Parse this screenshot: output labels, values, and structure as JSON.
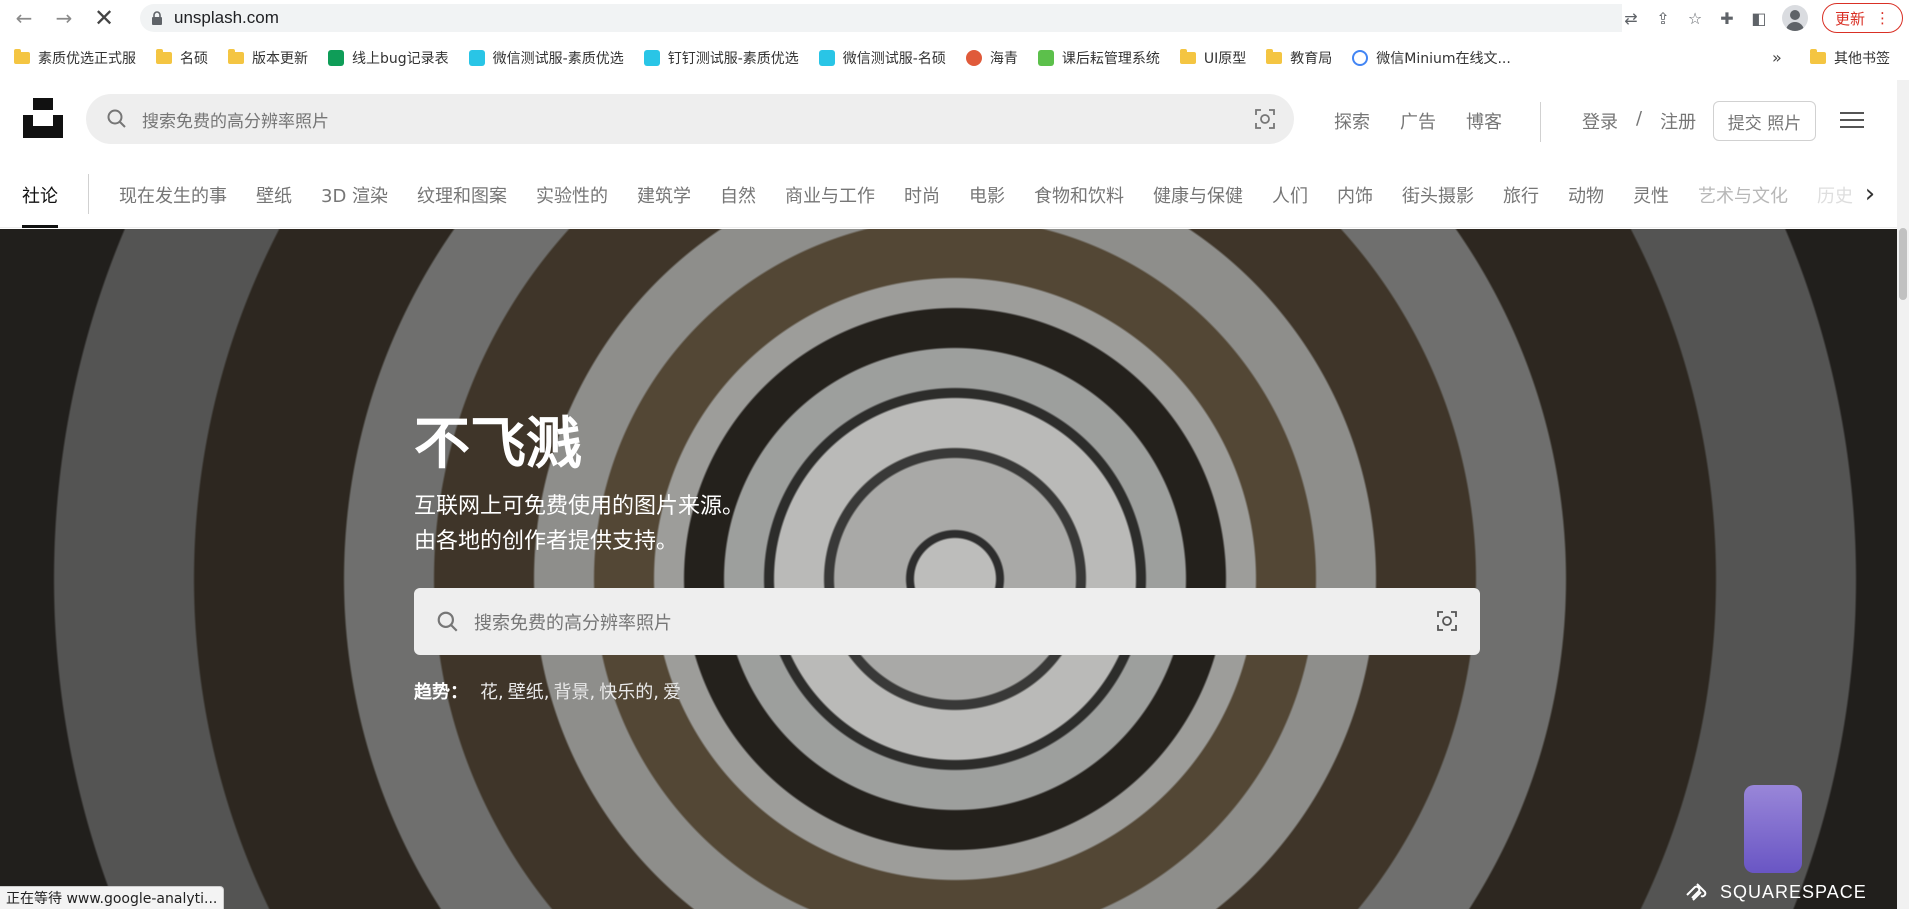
{
  "browser": {
    "url": "unsplash.com",
    "update_label": "更新",
    "status_text": "正在等待 www.google-analyti..."
  },
  "bookmarks": {
    "items": [
      {
        "label": "素质优选正式服",
        "icon": "folder-icon"
      },
      {
        "label": "名硕",
        "icon": "folder-icon"
      },
      {
        "label": "版本更新",
        "icon": "folder-icon"
      },
      {
        "label": "线上bug记录表",
        "icon": "sheet-icon"
      },
      {
        "label": "微信测试服-素质优选",
        "icon": "app-icon"
      },
      {
        "label": "钉钉测试服-素质优选",
        "icon": "app-icon"
      },
      {
        "label": "微信测试服-名硕",
        "icon": "app-icon"
      },
      {
        "label": "海青",
        "icon": "site-icon"
      },
      {
        "label": "课后耘管理系统",
        "icon": "site-icon"
      },
      {
        "label": "UI原型",
        "icon": "folder-icon"
      },
      {
        "label": "教育局",
        "icon": "folder-icon"
      },
      {
        "label": "微信Minium在线文...",
        "icon": "site-icon"
      }
    ],
    "more": "»",
    "other": "其他书签"
  },
  "header": {
    "search_placeholder": "搜索免费的高分辨率照片",
    "links": [
      "探索",
      "广告",
      "博客"
    ],
    "login": "登录",
    "separator": "/",
    "register": "注册",
    "submit": "提交 照片"
  },
  "topics": {
    "active": "社论",
    "items": [
      "现在发生的事",
      "壁纸",
      "3D 渲染",
      "纹理和图案",
      "实验性的",
      "建筑学",
      "自然",
      "商业与工作",
      "时尚",
      "电影",
      "食物和饮料",
      "健康与保健",
      "人们",
      "内饰",
      "街头摄影",
      "旅行",
      "动物",
      "灵性"
    ],
    "faded": [
      "艺术与文化",
      "历史"
    ]
  },
  "hero": {
    "title": "不飞溅",
    "subtitle_line1": "互联网上可免费使用的图片来源。",
    "subtitle_line2": "由各地的创作者提供支持。",
    "search_placeholder": "搜索免费的高分辨率照片",
    "trending_label": "趋势：",
    "trending": [
      "花,",
      "壁纸,",
      "背景,",
      "快乐的,",
      "爱"
    ]
  },
  "sponsor": "SQUARESPACE",
  "colors": {
    "update_red": "#d93025",
    "folder_yellow": "#f4c542"
  }
}
